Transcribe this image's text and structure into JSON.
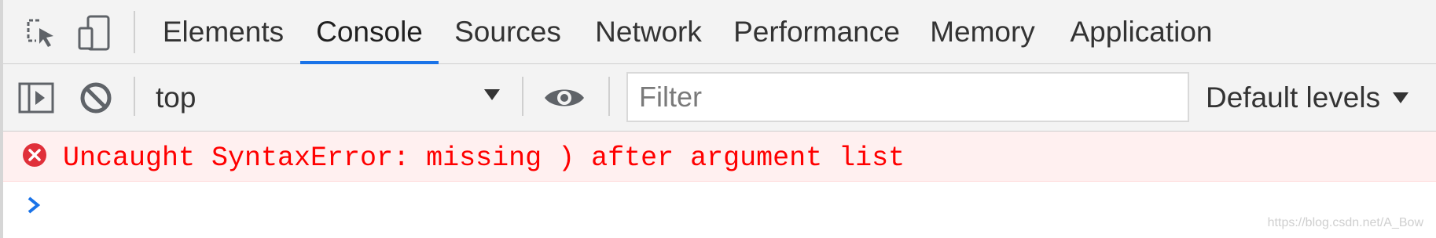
{
  "tabs": [
    {
      "label": "Elements",
      "active": false
    },
    {
      "label": "Console",
      "active": true
    },
    {
      "label": "Sources",
      "active": false
    },
    {
      "label": "Network",
      "active": false
    },
    {
      "label": "Performance",
      "active": false
    },
    {
      "label": "Memory",
      "active": false
    },
    {
      "label": "Application",
      "active": false
    }
  ],
  "toolbar": {
    "context": "top",
    "filter_placeholder": "Filter",
    "filter_value": "",
    "levels": "Default levels"
  },
  "console": {
    "messages": [
      {
        "level": "error",
        "text": "Uncaught SyntaxError: missing ) after argument list"
      }
    ]
  },
  "watermark": "https://blog.csdn.net/A_Bow",
  "icons": {
    "inspect": "inspect-element-icon",
    "device": "device-toggle-icon",
    "sidebar": "show-sidebar-icon",
    "clear": "clear-console-icon",
    "eye": "live-expression-eye-icon",
    "error": "error-circle-icon",
    "prompt": "prompt-chevron-icon"
  },
  "colors": {
    "accent": "#1a73e8",
    "error_text": "#ff0000",
    "error_background": "#fff0f0",
    "error_icon": "#e0303a",
    "toolbar_background": "#f3f3f3"
  }
}
